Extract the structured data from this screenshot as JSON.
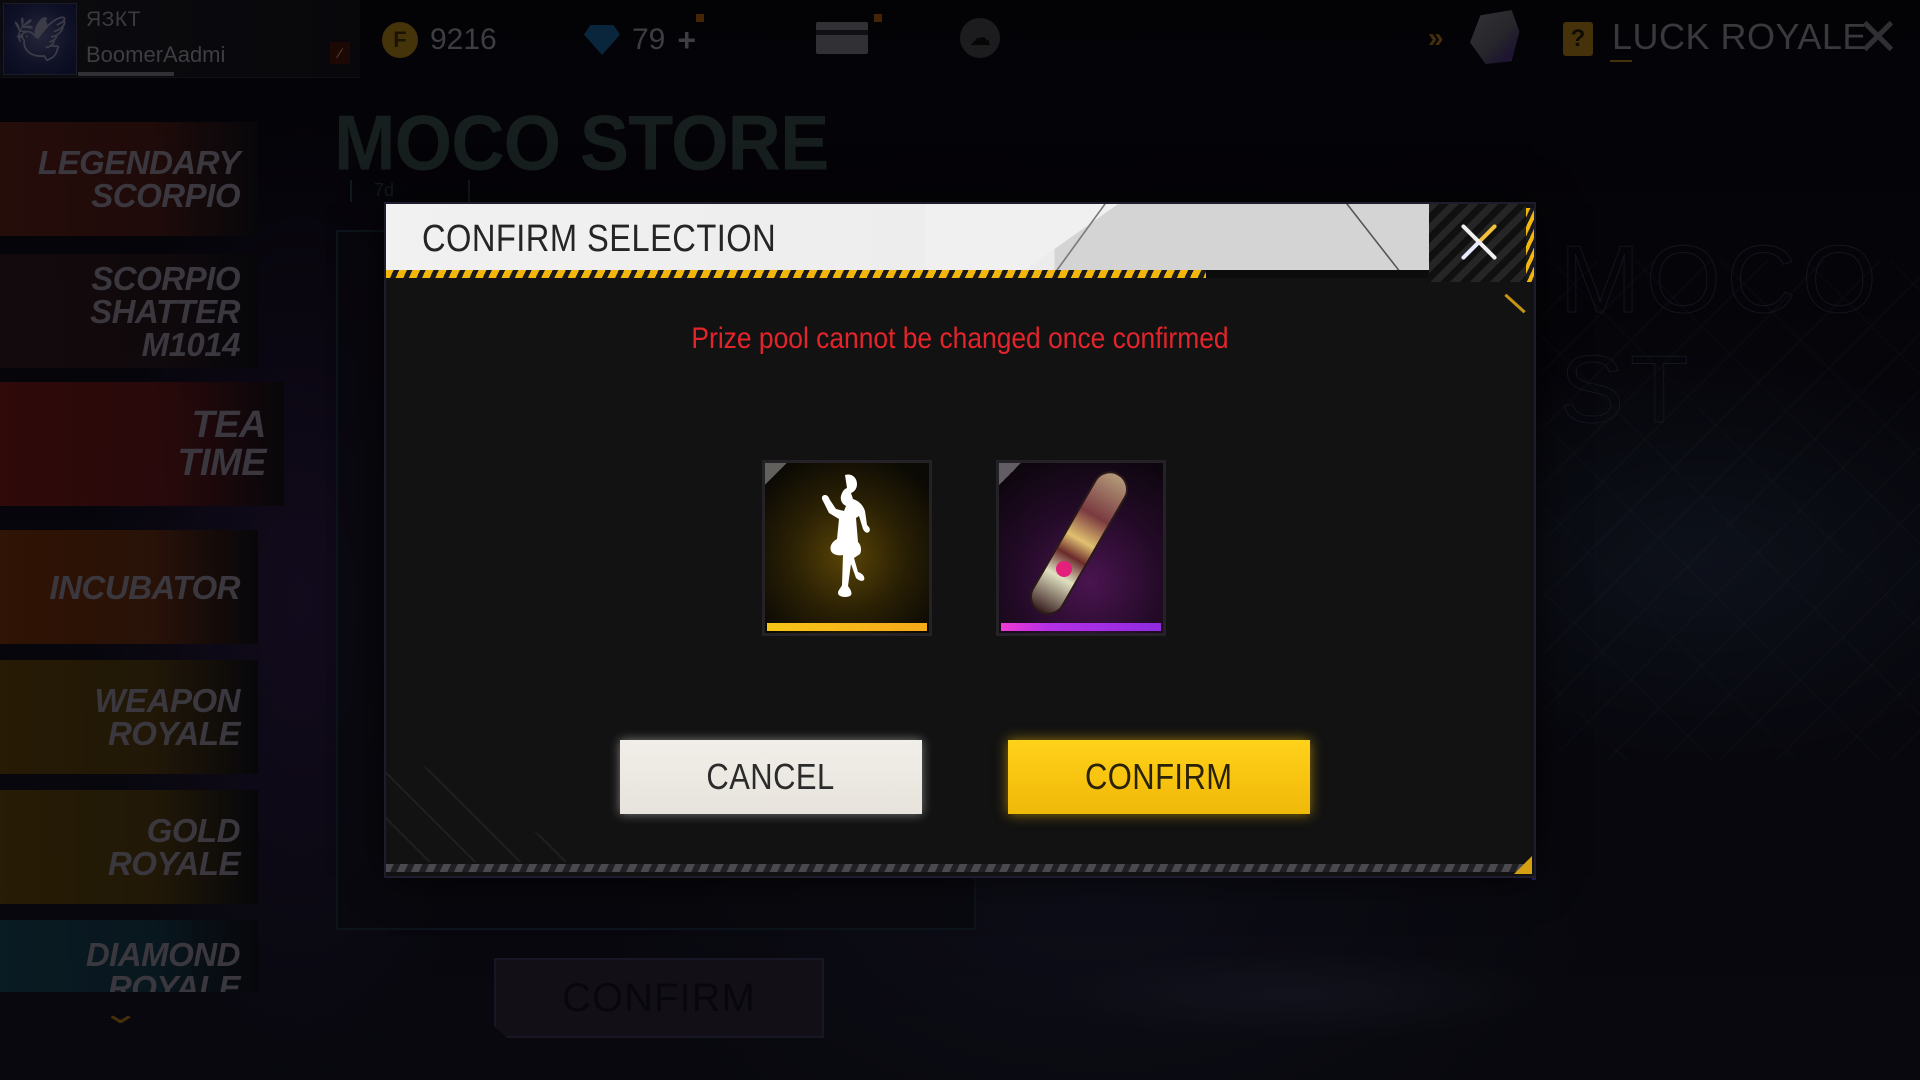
{
  "topbar": {
    "guild_tag": "ЯЗКТ",
    "nickname": "BoomerAadmi",
    "gold_amount": "9216",
    "diamond_amount": "79",
    "diamond_add_label": "+",
    "section_title": "LUCK ROYALE",
    "coin_glyph": "F",
    "help_glyph": "?",
    "icons": {
      "avatar": "eagle-avatar-icon",
      "gold": "gold-coin-icon",
      "diamond": "diamond-icon",
      "top_up": "card-diamond-icon",
      "cloud": "cloud-download-icon",
      "vault": "vault-icon",
      "help": "question-icon",
      "close": "close-icon"
    }
  },
  "menu": {
    "items": [
      {
        "label": "LEGENDARY SCORPIO",
        "line1": "LEGENDARY",
        "line2": "SCORPIO",
        "line3": "",
        "color": "#3a1410"
      },
      {
        "label": "SCORPIO SHATTER M1014",
        "line1": "SCORPIO",
        "line2": "SHATTER",
        "line3": "M1014",
        "color": "#1e1014"
      },
      {
        "label": "TEA TIME",
        "line1": "TEA",
        "line2": "TIME",
        "line3": "",
        "color": "#4a0f0f"
      },
      {
        "label": "INCUBATOR",
        "line1": "INCUBATOR",
        "line2": "",
        "line3": "",
        "color": "#4a1f08"
      },
      {
        "label": "WEAPON ROYALE",
        "line1": "WEAPON",
        "line2": "ROYALE",
        "line3": "",
        "color": "#3c2a08"
      },
      {
        "label": "GOLD ROYALE",
        "line1": "GOLD",
        "line2": "ROYALE",
        "line3": "",
        "color": "#3c2c08"
      },
      {
        "label": "DIAMOND ROYALE",
        "line1": "DIAMOND",
        "line2": "ROYALE",
        "line3": "",
        "color": "#0e2a36"
      }
    ],
    "more_chevron": "chevron-down-icon"
  },
  "store": {
    "title": "MOCO STORE",
    "timer": "7d",
    "watermark": "MOCO ST",
    "bottom_confirm_label": "CONFIRM"
  },
  "modal": {
    "title": "CONFIRM SELECTION",
    "warning": "Prize pool cannot be changed once confirmed",
    "prizes": [
      {
        "name": "Emote",
        "icon": "dance-emote-icon",
        "rarity": "legendary",
        "rarity_color": "#f5c518"
      },
      {
        "name": "Skateboard",
        "icon": "skateboard-icon",
        "rarity": "epic",
        "rarity_color": "#a22fe3"
      }
    ],
    "cancel_label": "CANCEL",
    "confirm_label": "CONFIRM",
    "colors": {
      "warning": "#e3242b",
      "confirm": "#f6c20e",
      "cancel": "#eeeae4",
      "hazard": "#f2b60d"
    }
  }
}
